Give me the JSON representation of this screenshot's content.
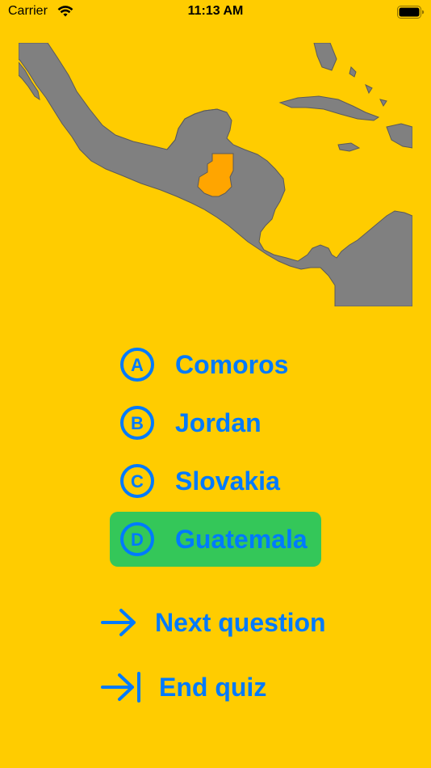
{
  "status_bar": {
    "carrier": "Carrier",
    "time": "11:13 AM",
    "wifi_icon": "wifi-icon",
    "battery_icon": "battery-full-icon"
  },
  "map": {
    "highlighted_country_color": "#FFA500",
    "land_color": "#808080",
    "background_color": "#FFCC00"
  },
  "answers": [
    {
      "letter": "A",
      "label": "Comoros",
      "state": "default"
    },
    {
      "letter": "B",
      "label": "Jordan",
      "state": "default"
    },
    {
      "letter": "C",
      "label": "Slovakia",
      "state": "default"
    },
    {
      "letter": "D",
      "label": "Guatemala",
      "state": "correct"
    }
  ],
  "actions": {
    "next": {
      "label": "Next question",
      "icon": "arrow-right-icon"
    },
    "end": {
      "label": "End quiz",
      "icon": "arrow-right-to-line-icon"
    }
  },
  "colors": {
    "accent": "#007AFF",
    "correct": "#34C759",
    "background": "#FFCC00"
  }
}
